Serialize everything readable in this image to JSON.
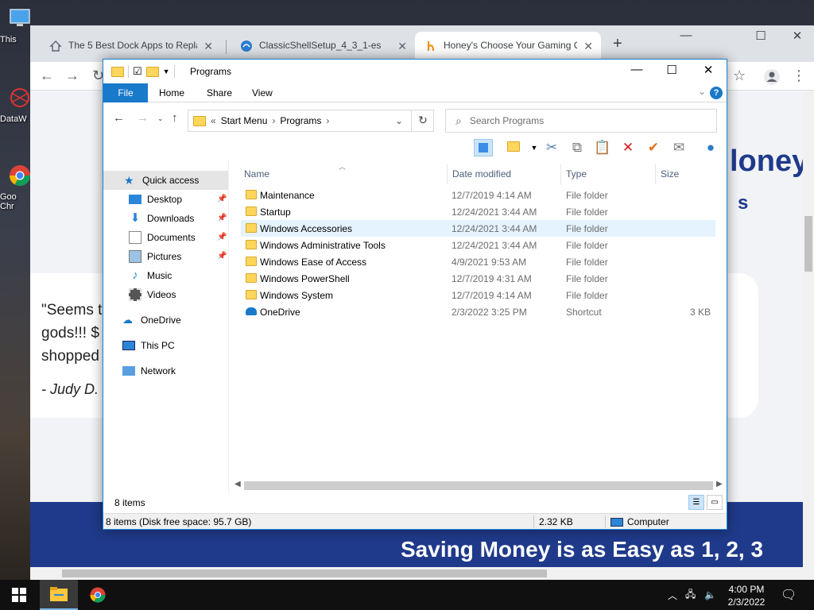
{
  "desktop": {
    "icons": [
      {
        "label": "This",
        "name": "this-pc"
      },
      {
        "label": "DataW",
        "name": "datawrapper"
      },
      {
        "label": "Goo Chr",
        "name": "google-chrome"
      }
    ]
  },
  "browser": {
    "tabs": [
      {
        "title": "The 5 Best Dock Apps to Replace",
        "icon": "home-icon"
      },
      {
        "title": "ClassicShellSetup_4_3_1-es",
        "icon": "edge-icon"
      },
      {
        "title": "Honey's Choose Your Gaming C",
        "icon": "honey-icon"
      }
    ],
    "page": {
      "header_fragment": "loney",
      "subheader_fragment": "s",
      "quote_lines": [
        "\"Seems t",
        "gods!!! $",
        "shopped"
      ],
      "quote_author": "- Judy D.",
      "banner_text": "Saving Money is as Easy as 1, 2, 3"
    }
  },
  "explorer": {
    "title": "Programs",
    "ribbon_tabs": [
      "File",
      "Home",
      "Share",
      "View"
    ],
    "breadcrumb": [
      "Start Menu",
      "Programs"
    ],
    "search_placeholder": "Search Programs",
    "nav": {
      "quick_access": "Quick access",
      "pinned": [
        "Desktop",
        "Downloads",
        "Documents",
        "Pictures"
      ],
      "others": [
        "Music",
        "Videos"
      ],
      "onedrive": "OneDrive",
      "this_pc": "This PC",
      "network": "Network"
    },
    "columns": [
      "Name",
      "Date modified",
      "Type",
      "Size"
    ],
    "files": [
      {
        "name": "Maintenance",
        "date": "12/7/2019 4:14 AM",
        "type": "File folder",
        "size": "",
        "icon": "folder-icon"
      },
      {
        "name": "Startup",
        "date": "12/24/2021 3:44 AM",
        "type": "File folder",
        "size": "",
        "icon": "folder-icon"
      },
      {
        "name": "Windows Accessories",
        "date": "12/24/2021 3:44 AM",
        "type": "File folder",
        "size": "",
        "icon": "folder-icon"
      },
      {
        "name": "Windows Administrative Tools",
        "date": "12/24/2021 3:44 AM",
        "type": "File folder",
        "size": "",
        "icon": "folder-icon"
      },
      {
        "name": "Windows Ease of Access",
        "date": "4/9/2021 9:53 AM",
        "type": "File folder",
        "size": "",
        "icon": "folder-icon"
      },
      {
        "name": "Windows PowerShell",
        "date": "12/7/2019 4:31 AM",
        "type": "File folder",
        "size": "",
        "icon": "folder-icon"
      },
      {
        "name": "Windows System",
        "date": "12/7/2019 4:14 AM",
        "type": "File folder",
        "size": "",
        "icon": "folder-icon"
      },
      {
        "name": "OneDrive",
        "date": "2/3/2022 3:25 PM",
        "type": "Shortcut",
        "size": "3 KB",
        "icon": "onedrive-shortcut-icon"
      }
    ],
    "item_count": "8 items",
    "status": {
      "summary": "8 items (Disk free space: 95.7 GB)",
      "size": "2.32 KB",
      "location": "Computer"
    }
  },
  "taskbar": {
    "time": "4:00 PM",
    "date": "2/3/2022"
  }
}
